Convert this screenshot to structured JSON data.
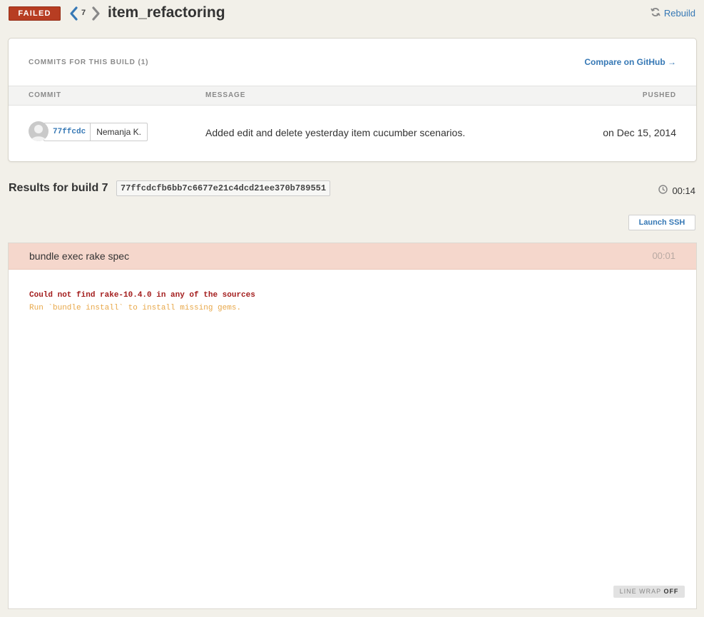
{
  "header": {
    "status": "FAILED",
    "build_number": "7",
    "branch": "item_refactoring",
    "rebuild_label": "Rebuild"
  },
  "commits": {
    "title": "COMMITS FOR THIS BUILD (1)",
    "compare_label": "Compare on GitHub →",
    "columns": [
      "COMMIT",
      "MESSAGE",
      "PUSHED"
    ],
    "rows": [
      {
        "sha": "77ffcdc",
        "author": "Nemanja K.",
        "message": "Added edit and delete yesterday item cucumber scenarios.",
        "pushed": "on Dec 15, 2014"
      }
    ]
  },
  "results": {
    "title": "Results for build 7",
    "full_sha": "77ffcdcfb6bb7c6677e21c4dcd21ee370b789551",
    "duration": "00:14",
    "launch_ssh_label": "Launch SSH"
  },
  "step": {
    "command": "bundle exec rake spec",
    "duration": "00:01",
    "output": [
      "Could not find rake-10.4.0 in any of the sources",
      "Run `bundle install` to install missing gems."
    ],
    "line_wrap_label": "LINE WRAP",
    "line_wrap_state": "OFF"
  },
  "colors": {
    "failed_badge": "#b73d22",
    "link": "#3678b5",
    "step_header_failed": "#f5d7cc",
    "error_text": "#a31d1d",
    "warning_text": "#e8a84a"
  }
}
